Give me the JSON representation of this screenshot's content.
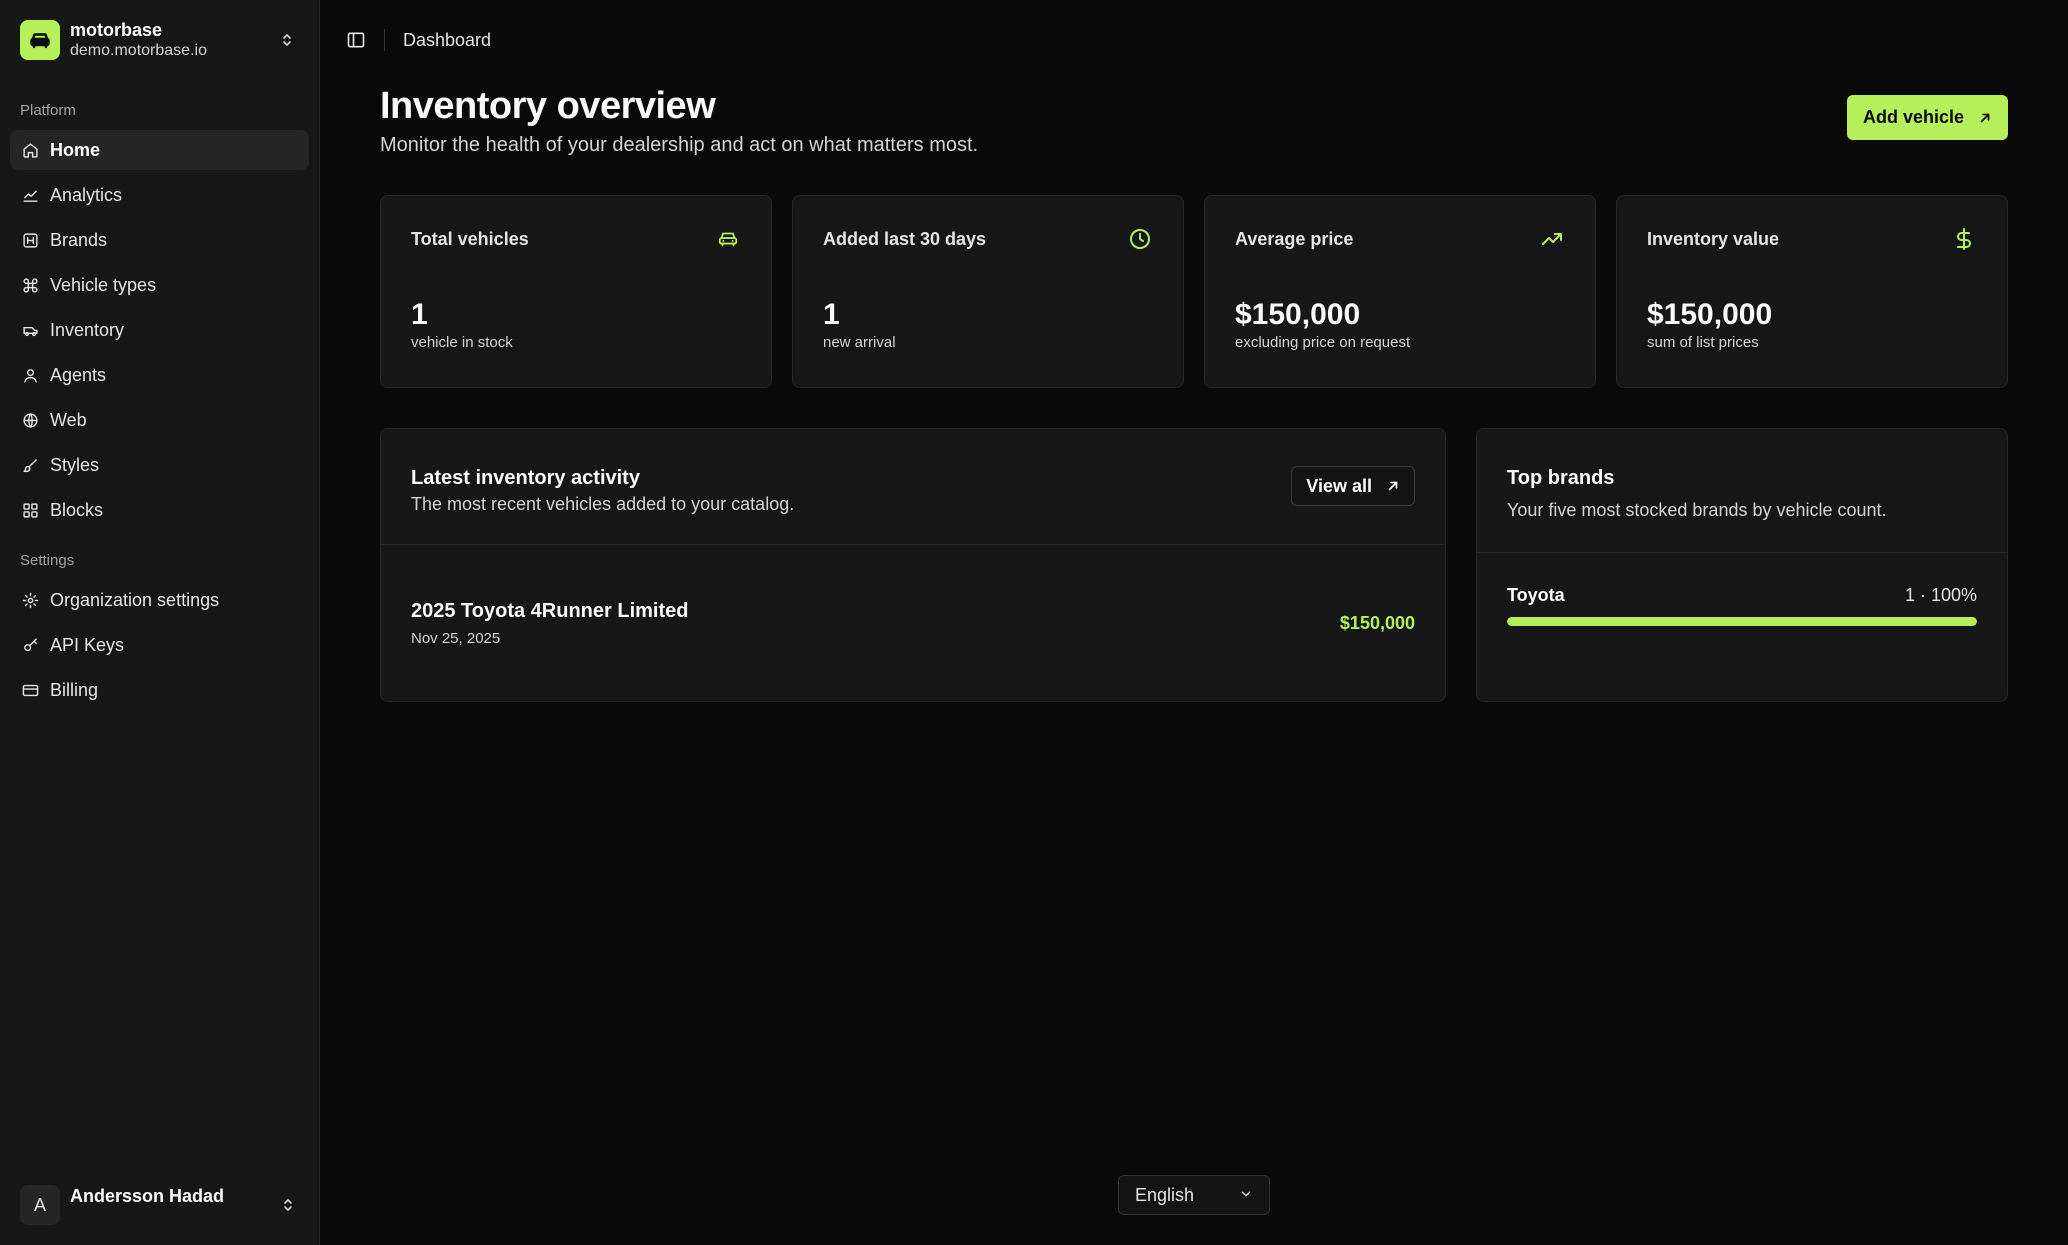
{
  "org": {
    "name": "motorbase",
    "url": "demo.motorbase.io"
  },
  "sidebar": {
    "platform_label": "Platform",
    "platform_items": [
      {
        "label": "Home",
        "icon": "home-icon"
      },
      {
        "label": "Analytics",
        "icon": "chart-line-icon"
      },
      {
        "label": "Brands",
        "icon": "brand-icon"
      },
      {
        "label": "Vehicle types",
        "icon": "command-icon"
      },
      {
        "label": "Inventory",
        "icon": "truck-icon"
      },
      {
        "label": "Agents",
        "icon": "user-icon"
      },
      {
        "label": "Web",
        "icon": "globe-icon"
      },
      {
        "label": "Styles",
        "icon": "brush-icon"
      },
      {
        "label": "Blocks",
        "icon": "blocks-icon"
      }
    ],
    "settings_label": "Settings",
    "settings_items": [
      {
        "label": "Organization settings",
        "icon": "gear-icon"
      },
      {
        "label": "API Keys",
        "icon": "key-icon"
      },
      {
        "label": "Billing",
        "icon": "credit-card-icon"
      }
    ],
    "active": "Home"
  },
  "user": {
    "initial": "A",
    "name": "Andersson Hadad"
  },
  "topbar": {
    "breadcrumb": "Dashboard"
  },
  "header": {
    "title": "Inventory overview",
    "subtitle": "Monitor the health of your dealership and act on what matters most.",
    "add_button": "Add vehicle"
  },
  "stats": [
    {
      "title": "Total vehicles",
      "value": "1",
      "caption": "vehicle in stock",
      "icon": "car-icon"
    },
    {
      "title": "Added last 30 days",
      "value": "1",
      "caption": "new arrival",
      "icon": "clock-icon"
    },
    {
      "title": "Average price",
      "value": "$150,000",
      "caption": "excluding price on request",
      "icon": "trending-up-icon"
    },
    {
      "title": "Inventory value",
      "value": "$150,000",
      "caption": "sum of list prices",
      "icon": "dollar-icon"
    }
  ],
  "activity": {
    "title": "Latest inventory activity",
    "subtitle": "The most recent vehicles added to your catalog.",
    "view_all": "View all",
    "items": [
      {
        "name": "2025 Toyota 4Runner Limited",
        "date": "Nov 25, 2025",
        "price": "$150,000"
      }
    ]
  },
  "brands": {
    "title": "Top brands",
    "subtitle": "Your five most stocked brands by vehicle count.",
    "items": [
      {
        "name": "Toyota",
        "stat": "1 · 100%",
        "share": 1.0
      }
    ]
  },
  "language": {
    "selected": "English"
  },
  "colors": {
    "accent": "#b5f05a",
    "background": "#0a0a0a",
    "card": "#171717"
  }
}
